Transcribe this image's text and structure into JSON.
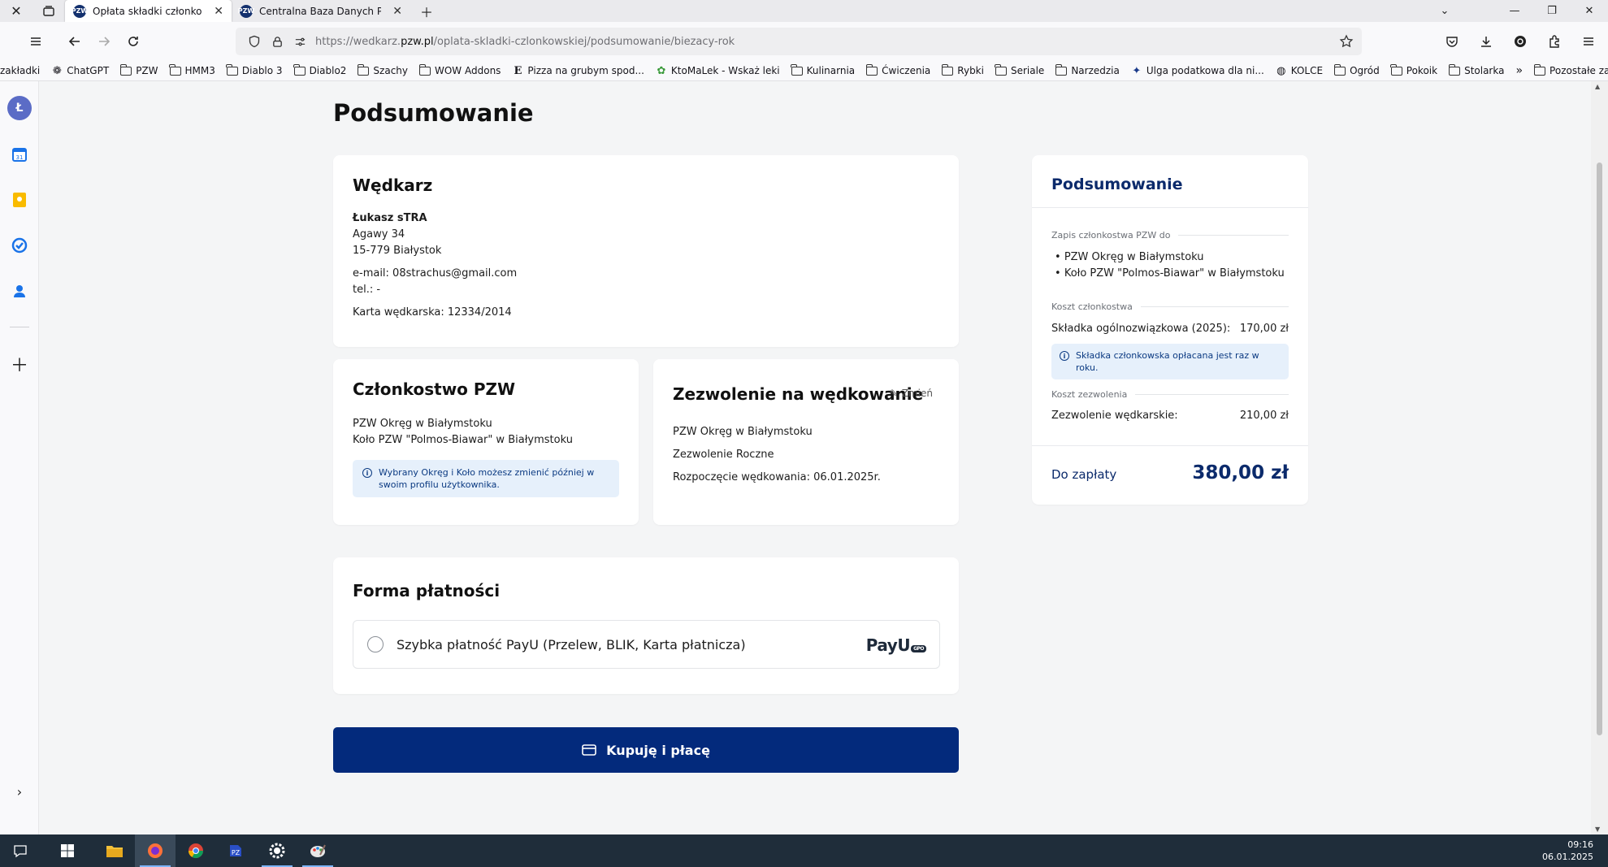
{
  "browser": {
    "tabs": [
      {
        "title": "Opłata składki członkowskiej C",
        "active": true
      },
      {
        "title": "Centralna Baza Danych PZW",
        "active": false
      }
    ],
    "url_prefix": "https://wedkarz.",
    "url_domain": "pzw.pl",
    "url_path": "/oplata-skladki-czlonkowskiej/podsumowanie/biezacy-rok",
    "bookmarks": [
      {
        "label": "zakładki",
        "icon": "none"
      },
      {
        "label": "ChatGPT",
        "icon": "chatgpt-icon"
      },
      {
        "label": "PZW",
        "icon": "folder-icon"
      },
      {
        "label": "HMM3",
        "icon": "folder-icon"
      },
      {
        "label": "Diablo 3",
        "icon": "folder-icon"
      },
      {
        "label": "Diablo2",
        "icon": "folder-icon"
      },
      {
        "label": "Szachy",
        "icon": "folder-icon"
      },
      {
        "label": "WOW Addons",
        "icon": "folder-icon"
      },
      {
        "label": "Pizza na grubym spod...",
        "icon": "letter-e-icon"
      },
      {
        "label": "KtoMaLek - Wskaż leki",
        "icon": "pill-icon"
      },
      {
        "label": "Kulinarnia",
        "icon": "folder-icon"
      },
      {
        "label": "Ćwiczenia",
        "icon": "folder-icon"
      },
      {
        "label": "Rybki",
        "icon": "folder-icon"
      },
      {
        "label": "Seriale",
        "icon": "folder-icon"
      },
      {
        "label": "Narzedzia",
        "icon": "folder-icon"
      },
      {
        "label": "Ulga podatkowa dla ni...",
        "icon": "eagle-icon"
      },
      {
        "label": "KOLCE",
        "icon": "globe-icon"
      },
      {
        "label": "Ogród",
        "icon": "folder-icon"
      },
      {
        "label": "Pokoik",
        "icon": "folder-icon"
      },
      {
        "label": "Stolarka",
        "icon": "folder-icon"
      }
    ],
    "other_bookmarks": "Pozostałe zakładki",
    "sidebar_avatar": "Ł",
    "clock_time": "09:16",
    "clock_date": "06.01.2025"
  },
  "page": {
    "title": "Podsumowanie",
    "angler": {
      "heading": "Wędkarz",
      "name": "Łukasz sTRA",
      "street": "Agawy 34",
      "city": "15-779 Białystok",
      "email": "e-mail: 08strachus@gmail.com",
      "phone": "tel.: -",
      "card": "Karta wędkarska: 12334/2014"
    },
    "membership": {
      "heading": "Członkostwo PZW",
      "district": "PZW Okręg w Białymstoku",
      "club": "Koło PZW \"Polmos-Biawar\" w Białymstoku",
      "info": "Wybrany Okręg i Koło możesz zmienić później w swoim profilu użytkownika."
    },
    "permit": {
      "heading": "Zezwolenie na wędkowanie",
      "edit_label": "Zmień",
      "district": "PZW Okręg w Białymstoku",
      "type": "Zezwolenie Roczne",
      "start": "Rozpoczęcie wędkowania: 06.01.2025r."
    },
    "payment": {
      "heading": "Forma płatności",
      "option_label": "Szybka płatność PayU (Przelew, BLIK, Karta płatnicza)",
      "logo_text": "PayU",
      "logo_badge": "GPO"
    },
    "buy_button": "Kupuję i płacę",
    "summary": {
      "heading": "Podsumowanie",
      "membership_section": "Zapis członkostwa PZW do",
      "membership_items": [
        "PZW Okręg w Białymstoku",
        "Koło PZW \"Polmos-Biawar\" w Białymstoku"
      ],
      "cost_section": "Koszt członkostwa",
      "fee_label": "Składka ogólnozwiązkowa (2025):",
      "fee_value": "170,00 zł",
      "fee_info": "Składka członkowska opłacana jest raz w roku.",
      "permit_section": "Koszt zezwolenia",
      "permit_label": "Zezwolenie wędkarskie:",
      "permit_value": "210,00 zł",
      "total_label": "Do zapłaty",
      "total_value": "380,00 zł"
    }
  },
  "colors": {
    "primary": "#032a7c",
    "summary_title": "#0b2a6b",
    "info_bg": "#e6f0fb"
  }
}
